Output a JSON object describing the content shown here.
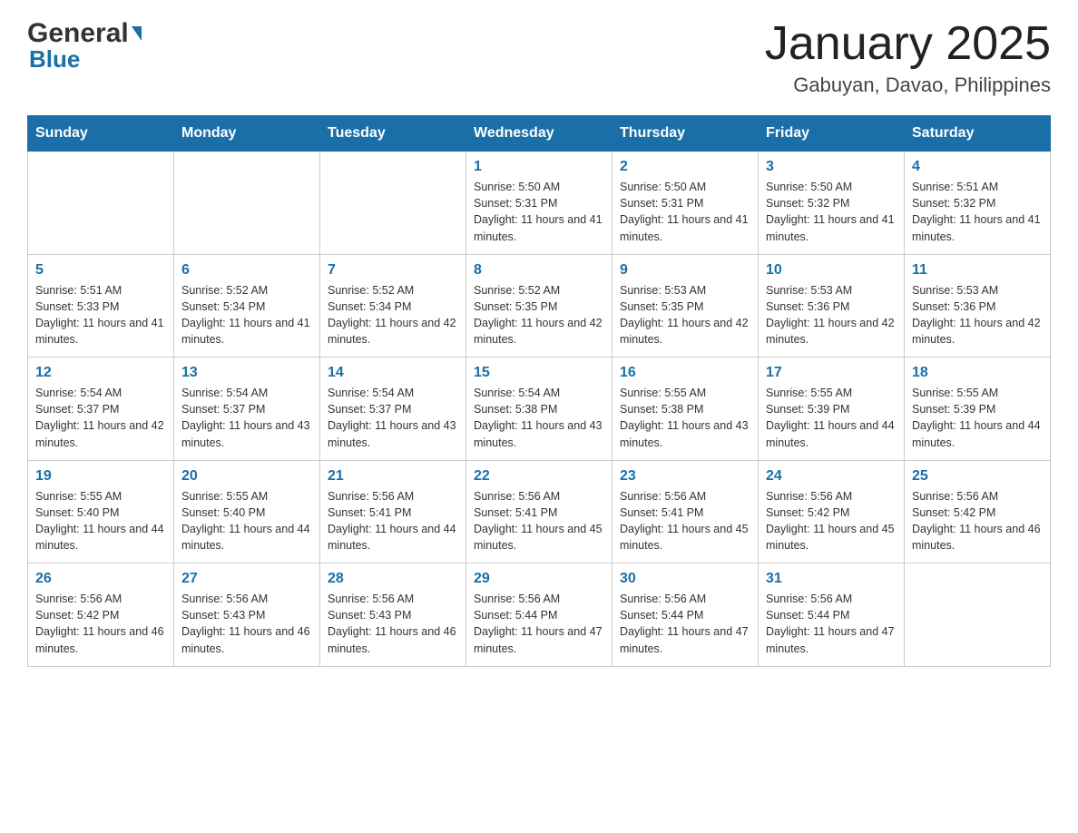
{
  "header": {
    "logo_general": "General",
    "logo_blue": "Blue",
    "title": "January 2025",
    "subtitle": "Gabuyan, Davao, Philippines"
  },
  "calendar": {
    "days_of_week": [
      "Sunday",
      "Monday",
      "Tuesday",
      "Wednesday",
      "Thursday",
      "Friday",
      "Saturday"
    ],
    "weeks": [
      [
        {
          "day": "",
          "info": ""
        },
        {
          "day": "",
          "info": ""
        },
        {
          "day": "",
          "info": ""
        },
        {
          "day": "1",
          "info": "Sunrise: 5:50 AM\nSunset: 5:31 PM\nDaylight: 11 hours and 41 minutes."
        },
        {
          "day": "2",
          "info": "Sunrise: 5:50 AM\nSunset: 5:31 PM\nDaylight: 11 hours and 41 minutes."
        },
        {
          "day": "3",
          "info": "Sunrise: 5:50 AM\nSunset: 5:32 PM\nDaylight: 11 hours and 41 minutes."
        },
        {
          "day": "4",
          "info": "Sunrise: 5:51 AM\nSunset: 5:32 PM\nDaylight: 11 hours and 41 minutes."
        }
      ],
      [
        {
          "day": "5",
          "info": "Sunrise: 5:51 AM\nSunset: 5:33 PM\nDaylight: 11 hours and 41 minutes."
        },
        {
          "day": "6",
          "info": "Sunrise: 5:52 AM\nSunset: 5:34 PM\nDaylight: 11 hours and 41 minutes."
        },
        {
          "day": "7",
          "info": "Sunrise: 5:52 AM\nSunset: 5:34 PM\nDaylight: 11 hours and 42 minutes."
        },
        {
          "day": "8",
          "info": "Sunrise: 5:52 AM\nSunset: 5:35 PM\nDaylight: 11 hours and 42 minutes."
        },
        {
          "day": "9",
          "info": "Sunrise: 5:53 AM\nSunset: 5:35 PM\nDaylight: 11 hours and 42 minutes."
        },
        {
          "day": "10",
          "info": "Sunrise: 5:53 AM\nSunset: 5:36 PM\nDaylight: 11 hours and 42 minutes."
        },
        {
          "day": "11",
          "info": "Sunrise: 5:53 AM\nSunset: 5:36 PM\nDaylight: 11 hours and 42 minutes."
        }
      ],
      [
        {
          "day": "12",
          "info": "Sunrise: 5:54 AM\nSunset: 5:37 PM\nDaylight: 11 hours and 42 minutes."
        },
        {
          "day": "13",
          "info": "Sunrise: 5:54 AM\nSunset: 5:37 PM\nDaylight: 11 hours and 43 minutes."
        },
        {
          "day": "14",
          "info": "Sunrise: 5:54 AM\nSunset: 5:37 PM\nDaylight: 11 hours and 43 minutes."
        },
        {
          "day": "15",
          "info": "Sunrise: 5:54 AM\nSunset: 5:38 PM\nDaylight: 11 hours and 43 minutes."
        },
        {
          "day": "16",
          "info": "Sunrise: 5:55 AM\nSunset: 5:38 PM\nDaylight: 11 hours and 43 minutes."
        },
        {
          "day": "17",
          "info": "Sunrise: 5:55 AM\nSunset: 5:39 PM\nDaylight: 11 hours and 44 minutes."
        },
        {
          "day": "18",
          "info": "Sunrise: 5:55 AM\nSunset: 5:39 PM\nDaylight: 11 hours and 44 minutes."
        }
      ],
      [
        {
          "day": "19",
          "info": "Sunrise: 5:55 AM\nSunset: 5:40 PM\nDaylight: 11 hours and 44 minutes."
        },
        {
          "day": "20",
          "info": "Sunrise: 5:55 AM\nSunset: 5:40 PM\nDaylight: 11 hours and 44 minutes."
        },
        {
          "day": "21",
          "info": "Sunrise: 5:56 AM\nSunset: 5:41 PM\nDaylight: 11 hours and 44 minutes."
        },
        {
          "day": "22",
          "info": "Sunrise: 5:56 AM\nSunset: 5:41 PM\nDaylight: 11 hours and 45 minutes."
        },
        {
          "day": "23",
          "info": "Sunrise: 5:56 AM\nSunset: 5:41 PM\nDaylight: 11 hours and 45 minutes."
        },
        {
          "day": "24",
          "info": "Sunrise: 5:56 AM\nSunset: 5:42 PM\nDaylight: 11 hours and 45 minutes."
        },
        {
          "day": "25",
          "info": "Sunrise: 5:56 AM\nSunset: 5:42 PM\nDaylight: 11 hours and 46 minutes."
        }
      ],
      [
        {
          "day": "26",
          "info": "Sunrise: 5:56 AM\nSunset: 5:42 PM\nDaylight: 11 hours and 46 minutes."
        },
        {
          "day": "27",
          "info": "Sunrise: 5:56 AM\nSunset: 5:43 PM\nDaylight: 11 hours and 46 minutes."
        },
        {
          "day": "28",
          "info": "Sunrise: 5:56 AM\nSunset: 5:43 PM\nDaylight: 11 hours and 46 minutes."
        },
        {
          "day": "29",
          "info": "Sunrise: 5:56 AM\nSunset: 5:44 PM\nDaylight: 11 hours and 47 minutes."
        },
        {
          "day": "30",
          "info": "Sunrise: 5:56 AM\nSunset: 5:44 PM\nDaylight: 11 hours and 47 minutes."
        },
        {
          "day": "31",
          "info": "Sunrise: 5:56 AM\nSunset: 5:44 PM\nDaylight: 11 hours and 47 minutes."
        },
        {
          "day": "",
          "info": ""
        }
      ]
    ]
  }
}
